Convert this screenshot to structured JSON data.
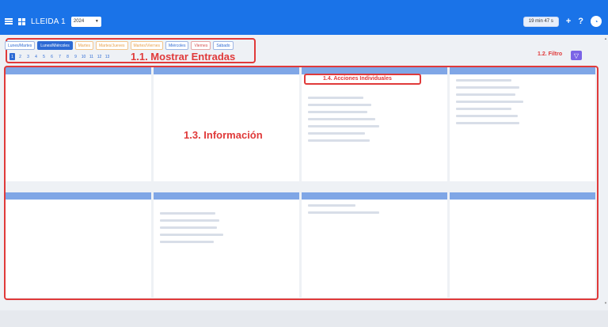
{
  "header": {
    "title": "LLEIDA 1",
    "year": "2024",
    "timer": "19 min 47 s",
    "add_label": "+",
    "help_label": "?"
  },
  "filters": {
    "chips": [
      {
        "label": "Lunes/Martes",
        "style": "blue",
        "active": false
      },
      {
        "label": "Lunes/Miércoles",
        "style": "blue",
        "active": true
      },
      {
        "label": "Martes",
        "style": "orange",
        "active": false
      },
      {
        "label": "Martes/Jueves",
        "style": "orange",
        "active": false
      },
      {
        "label": "Martes/Viernes",
        "style": "orange",
        "active": false
      },
      {
        "label": "Miércoles",
        "style": "blue",
        "active": false
      },
      {
        "label": "Viernes",
        "style": "red",
        "active": false
      },
      {
        "label": "Sábado",
        "style": "blue",
        "active": false
      }
    ],
    "pages": [
      "1",
      "2",
      "3",
      "4",
      "5",
      "6",
      "7",
      "8",
      "9",
      "10",
      "11",
      "12",
      "13"
    ],
    "active_page": "1"
  },
  "annotations": {
    "a11": "1.1. Mostrar Entradas",
    "a12": "1.2. Filtro",
    "a13": "1.3. Información",
    "a14": "1.4. Acciones Individuales"
  },
  "colors": {
    "topbar": "#1a73e8",
    "annotation": "#e03a3a",
    "filter_button": "#7a63e6"
  },
  "icons": {
    "menu": "menu-icon",
    "apps": "grid-icon",
    "filter": "filter-icon",
    "user": "avatar-icon"
  }
}
